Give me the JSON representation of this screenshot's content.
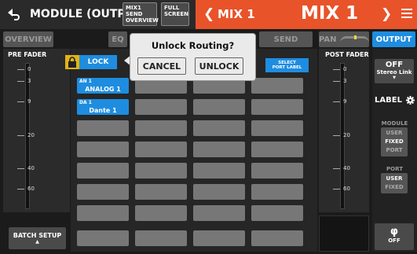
{
  "header": {
    "title": "MODULE (OUTPUT)",
    "mix_overview_label": "MIX1\nSEND\nOVERVIEW",
    "full_screen_label": "FULL\nSCREEN",
    "channel_name": "MIX 1",
    "channel_big": "MIX 1",
    "accent": "#e8532a"
  },
  "tabs": {
    "overview": "OVERVIEW",
    "eq": "EQ",
    "send": "SEND",
    "pan": "PAN",
    "output": "OUTPUT"
  },
  "left": {
    "pre_fader_label": "PRE FADER",
    "scale": [
      "0",
      "3",
      "9",
      "20",
      "40",
      "60"
    ],
    "batch_setup_label": "BATCH SETUP",
    "batch_setup_arrow": "▲"
  },
  "routing": {
    "lock_label": "LOCK",
    "select_port_label_line1": "SELECT",
    "select_port_label_line2": "PORT LABEL",
    "assigned": [
      {
        "port": "AN 1",
        "name": "ANALOG 1"
      },
      {
        "port": "DA 1",
        "name": "Dante 1"
      }
    ]
  },
  "dialog": {
    "title": "Unlock Routing?",
    "cancel_label": "CANCEL",
    "unlock_label": "UNLOCK"
  },
  "right": {
    "post_fader_label": "POST FADER",
    "scale": [
      "0",
      "3",
      "9",
      "20",
      "40",
      "60"
    ],
    "stereo_link_state": "OFF",
    "stereo_link_label": "Stereo Link",
    "label_title": "LABEL",
    "module_head": "MODULE",
    "module_opts": [
      "USER",
      "FIXED",
      "PORT"
    ],
    "port_head": "PORT",
    "port_opts": [
      "USER",
      "FIXED"
    ],
    "phase_symbol": "φ",
    "phase_state": "OFF"
  },
  "colors": {
    "blue": "#1e8de0",
    "lock_yellow": "#e1b315"
  }
}
